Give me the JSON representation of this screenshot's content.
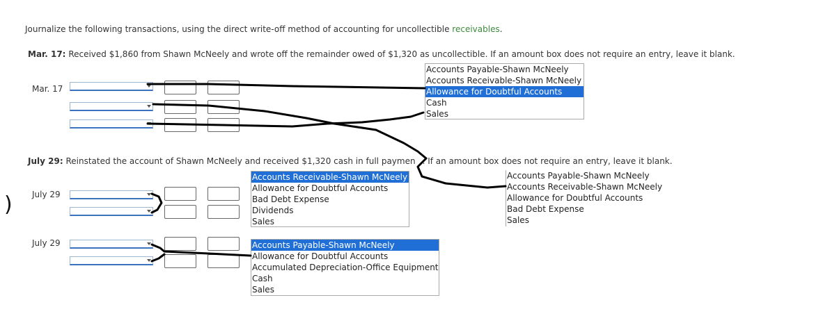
{
  "instruction": {
    "prefix": "Journalize the following transactions, using the direct write-off method of accounting for uncollectible ",
    "link": "receivables",
    "suffix": "."
  },
  "mar17": {
    "label": "Mar. 17:",
    "text": "Received $1,860 from Shawn McNeely and wrote off the remainder owed of $1,320 as uncollectible. If an amount box does not require an entry, leave it blank.",
    "row_date": "Mar. 17",
    "list": {
      "options": [
        "Accounts Payable-Shawn McNeely",
        "Accounts Receivable-Shawn McNeely",
        "Allowance for Doubtful Accounts",
        "Cash",
        "Sales"
      ],
      "selected": 2
    }
  },
  "jul29": {
    "label": "July 29:",
    "text_before": "Reinstated the account of Shawn McNeely and received $1,320 cash in full paymen",
    "text_after": ". If an amount box does not require an entry, leave it blank.",
    "row_date_1": "July 29",
    "row_date_2": "July 29",
    "list_a": {
      "options": [
        "Accounts Receivable-Shawn McNeely",
        "Allowance for Doubtful Accounts",
        "Bad Debt Expense",
        "Dividends",
        "Sales"
      ],
      "selected": 0
    },
    "list_b": {
      "options": [
        "Accounts Payable-Shawn McNeely",
        "Accounts Receivable-Shawn McNeely",
        "Allowance for Doubtful Accounts",
        "Bad Debt Expense",
        "Sales"
      ],
      "selected": -1
    },
    "list_c": {
      "options": [
        "Accounts Payable-Shawn McNeely",
        "Allowance for Doubtful Accounts",
        "Accumulated Depreciation-Office Equipment",
        "Cash",
        "Sales"
      ],
      "selected": 0
    }
  },
  "margin_glyph": ")",
  "colors": {
    "selected_bg": "#1f6fd6",
    "link": "#3b8a3b",
    "select_border": "#3a72c0"
  }
}
